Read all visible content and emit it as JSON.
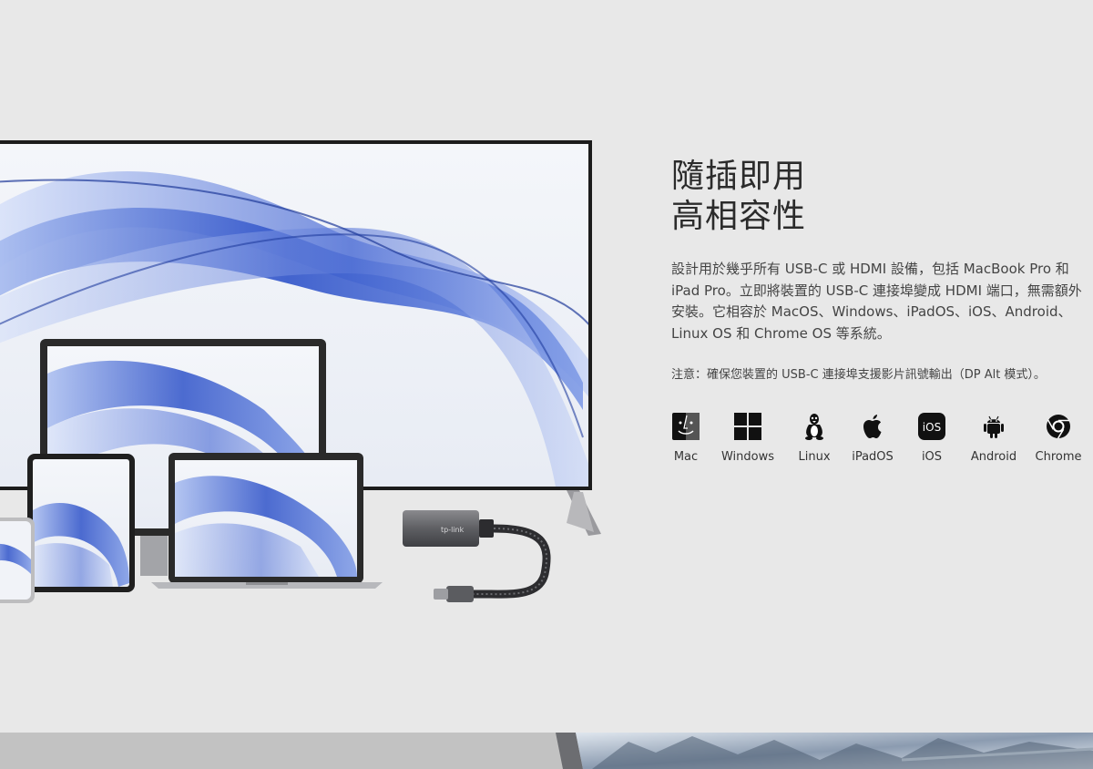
{
  "heading": {
    "line1": "隨插即用",
    "line2": "高相容性"
  },
  "description": "設計用於幾乎所有 USB-C 或 HDMI 設備，包括 MacBook Pro 和 iPad Pro。立即將裝置的 USB-C 連接埠變成 HDMI 端口，無需額外安裝。它相容於 MacOS、Windows、iPadOS、iOS、Android、Linux OS 和 Chrome OS 等系統。",
  "note": "注意：確保您裝置的 USB-C 連接埠支援影片訊號輸出（DP Alt 模式）。",
  "adapter_logo": "tp-link",
  "os": [
    {
      "label": "Mac",
      "icon": "mac-finder-icon"
    },
    {
      "label": "Windows",
      "icon": "windows-icon"
    },
    {
      "label": "Linux",
      "icon": "linux-tux-icon"
    },
    {
      "label": "iPadOS",
      "icon": "apple-icon"
    },
    {
      "label": "iOS",
      "icon": "ios-icon",
      "icon_text": "iOS"
    },
    {
      "label": "Android",
      "icon": "android-icon"
    },
    {
      "label": "Chrome",
      "icon": "chrome-icon"
    }
  ],
  "colors": {
    "background": "#e8e8e8",
    "wave_blue": "#2f53c9",
    "device_frame": "#222222"
  }
}
